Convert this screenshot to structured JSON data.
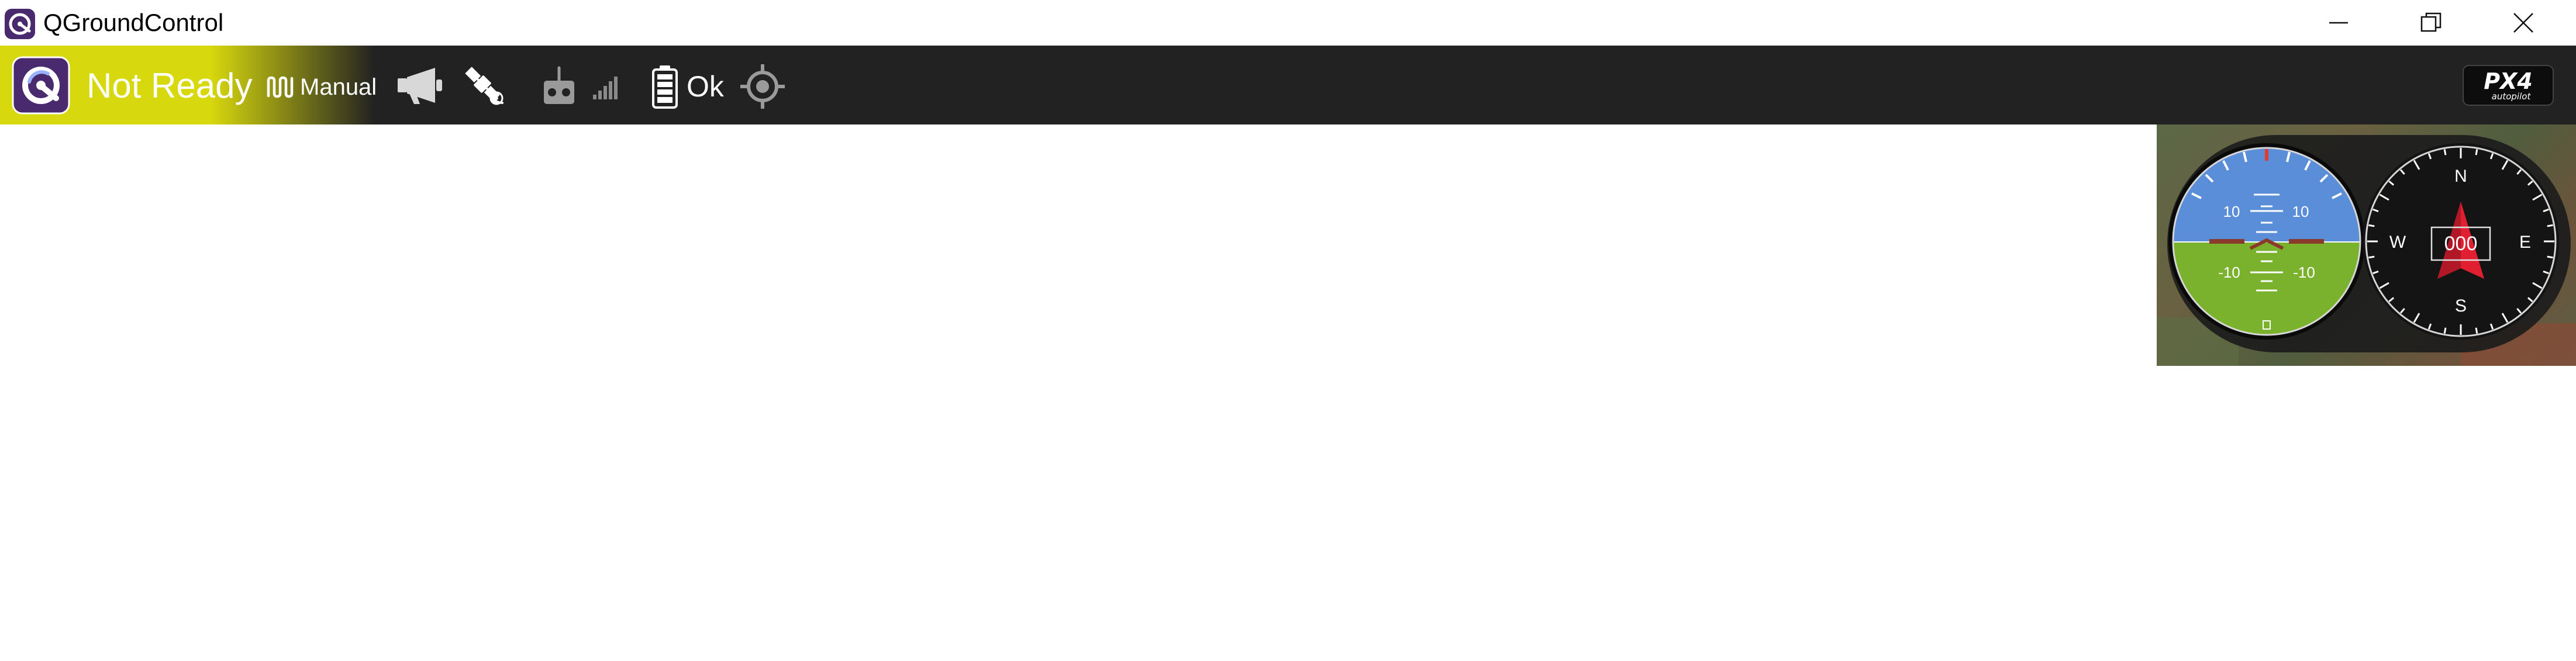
{
  "window": {
    "title": "QGroundControl",
    "controls": {
      "minimize": "minimize-icon",
      "maximize": "restore-icon",
      "close": "close-icon"
    }
  },
  "toolbar": {
    "status": "Not Ready",
    "status_color": "#d8d80e",
    "flight_mode": "Manual",
    "battery": "Ok",
    "icons": [
      "qgc-logo",
      "waveform-icon",
      "megaphone-icon",
      "satellite-icon",
      "remote-control-icon",
      "signal-bars-icon",
      "battery-icon",
      "gps-target-icon",
      "px4-logo"
    ],
    "px4_brand": "PX4",
    "px4_sub": "autopilot"
  },
  "attitude_indicator": {
    "pitch_scale_upper": [
      "10",
      "10"
    ],
    "pitch_scale_lower": [
      "-10",
      "-10"
    ],
    "sky_color": "#5a8ed8",
    "ground_color": "#7ab22d"
  },
  "compass": {
    "north": "N",
    "south": "S",
    "east": "E",
    "west": "W",
    "heading": "000",
    "needle_color": "#e02030"
  }
}
